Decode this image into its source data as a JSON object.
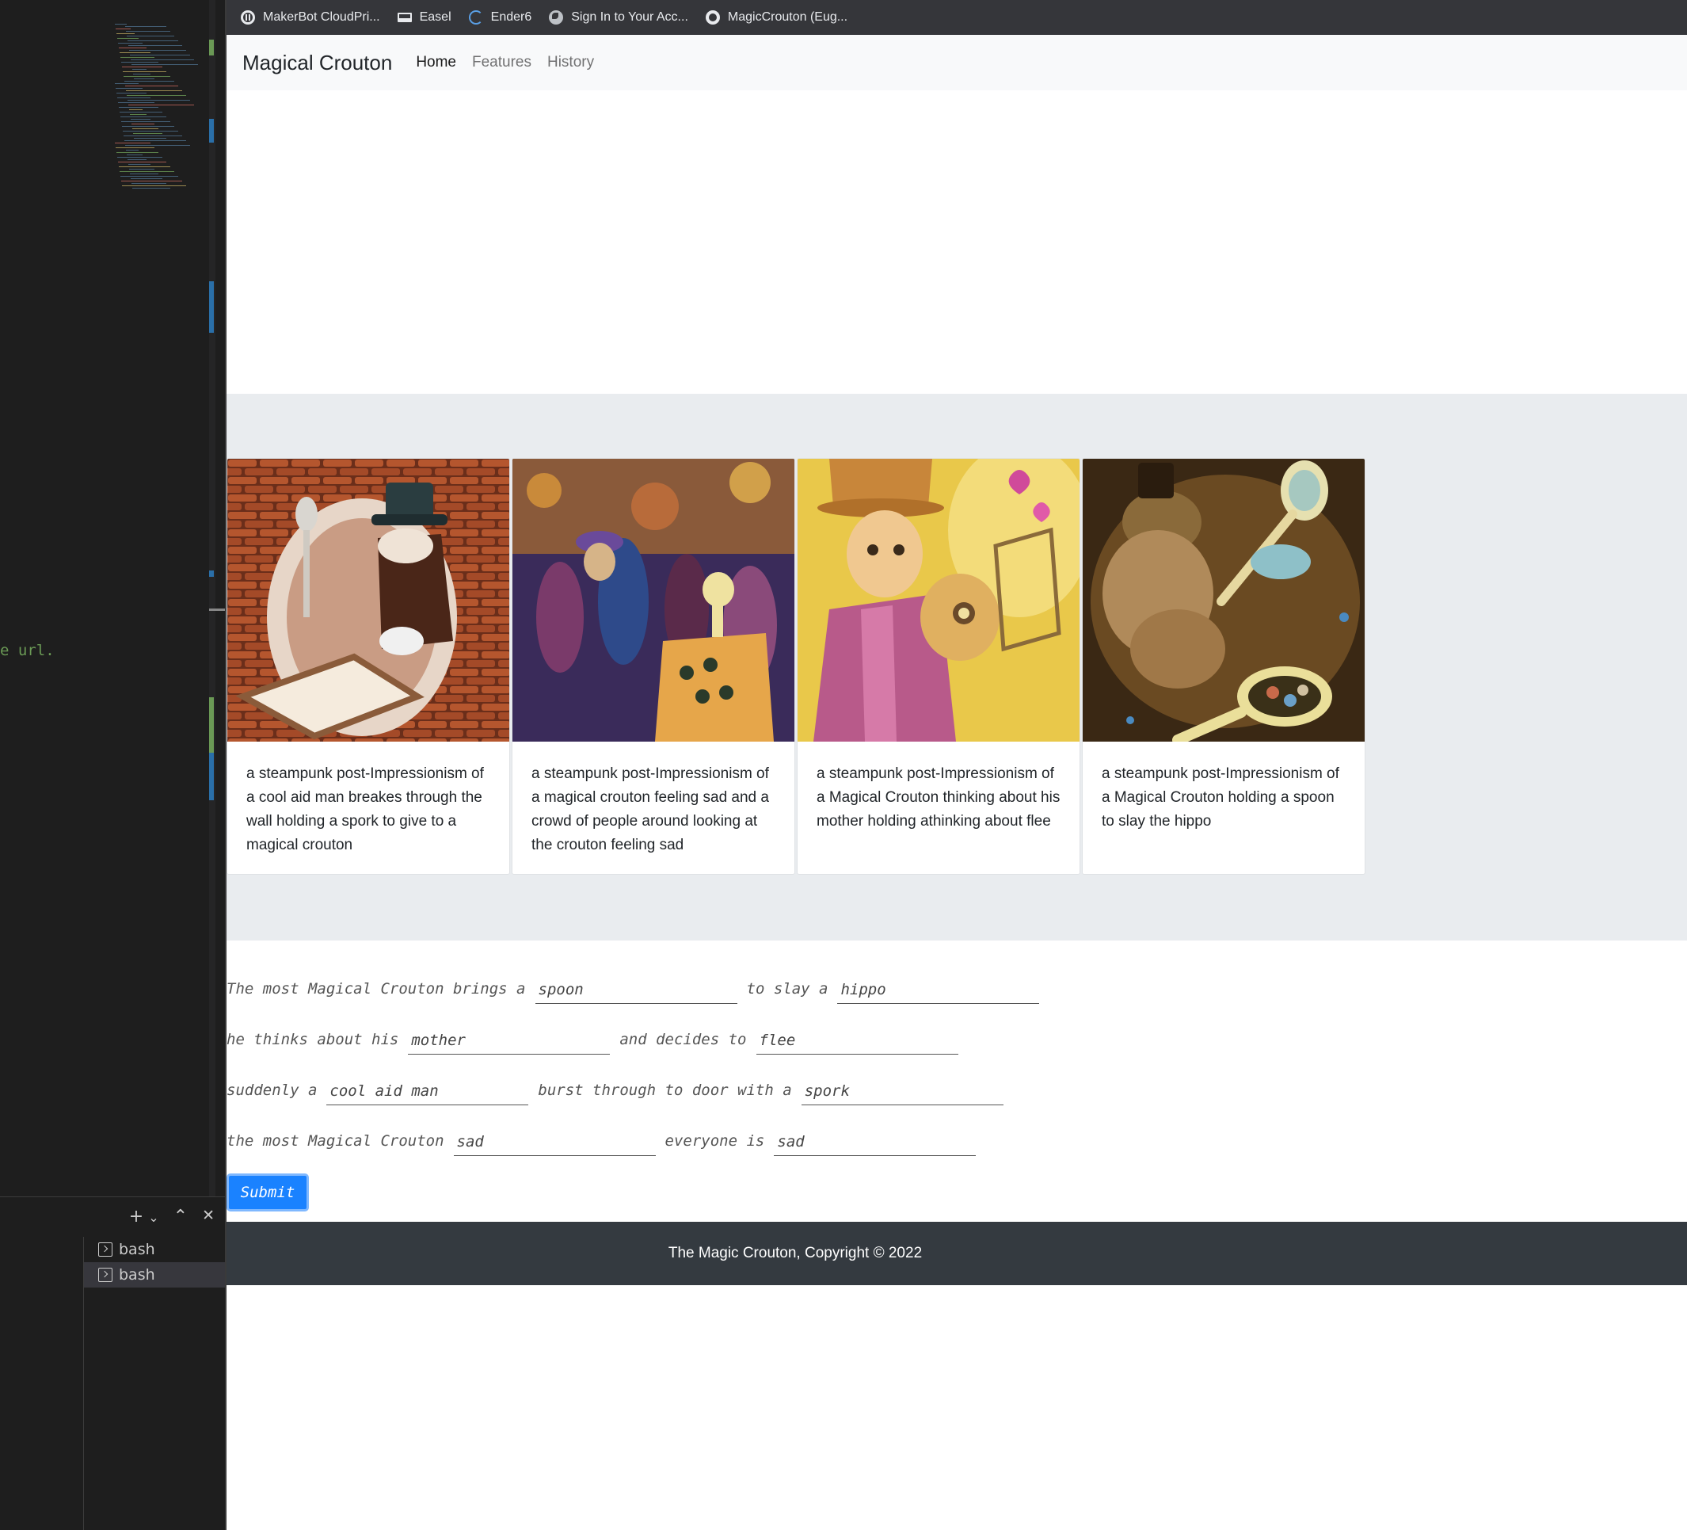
{
  "editor": {
    "code_fragment": "e url.",
    "terminal_tabs": [
      {
        "label": "bash"
      },
      {
        "label": "bash"
      }
    ],
    "terminal_actions": {
      "add_icon": "+",
      "dropdown_icon": "⌄",
      "maximize_icon": "⌃",
      "close_icon": "✕"
    }
  },
  "bookmarks": [
    {
      "label": "MakerBot CloudPri...",
      "icon": "makerbot-icon"
    },
    {
      "label": "Easel",
      "icon": "easel-icon"
    },
    {
      "label": "Ender6",
      "icon": "ender-icon"
    },
    {
      "label": "Sign In to Your Acc...",
      "icon": "globe-icon"
    },
    {
      "label": "MagicCrouton (Eug...",
      "icon": "github-icon"
    }
  ],
  "navbar": {
    "brand": "Magical Crouton",
    "links": [
      {
        "label": "Home",
        "active": true
      },
      {
        "label": "Features",
        "active": false
      },
      {
        "label": "History",
        "active": false
      }
    ]
  },
  "cards": [
    {
      "caption": "a steampunk post-Impressionism of a cool aid man breakes through the wall holding a spork to give to a magical crouton"
    },
    {
      "caption": "a steampunk post-Impressionism of a magical crouton feeling sad and a crowd of people around looking at the crouton feeling sad"
    },
    {
      "caption": "a steampunk post-Impressionism of a Magical Crouton thinking about his mother holding athinking about flee"
    },
    {
      "caption": "a steampunk post-Impressionism of a Magical Crouton holding a spoon to slay the hippo"
    }
  ],
  "form": {
    "row1": {
      "t1": "The most Magical Crouton brings a",
      "v1": "spoon",
      "t2": "to slay a",
      "v2": "hippo"
    },
    "row2": {
      "t1": "he thinks about his",
      "v1": "mother",
      "t2": "and decides to",
      "v2": "flee"
    },
    "row3": {
      "t1": "suddenly a",
      "v1": "cool aid man",
      "t2": "burst through to door with a",
      "v2": "spork"
    },
    "row4": {
      "t1": "the most Magical Crouton",
      "v1": "sad",
      "t2": "everyone is",
      "v2": "sad"
    },
    "submit_label": "Submit"
  },
  "footer": {
    "text": "The Magic Crouton, Copyright © 2022"
  },
  "colors": {
    "submit_bg": "#1a82ff",
    "footer_bg": "#343a40",
    "band_bg": "#e9ecef",
    "bookmarks_bg": "#35363a"
  }
}
